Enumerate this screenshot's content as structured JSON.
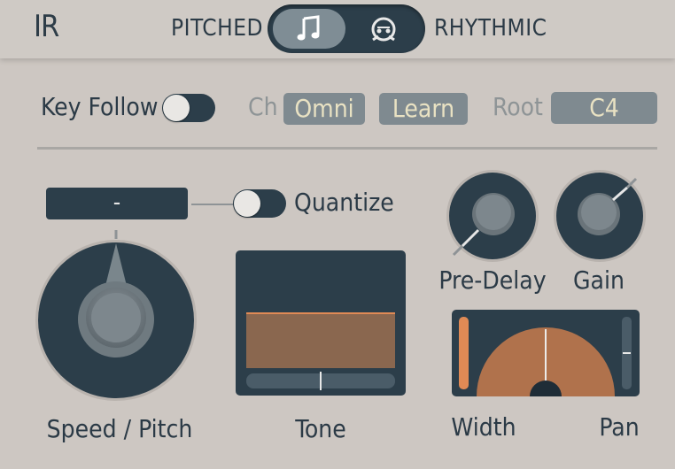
{
  "header": {
    "logo": "IR",
    "mode_left": "PITCHED",
    "mode_right": "RHYTHMIC",
    "selected_mode": "PITCHED"
  },
  "keyrow": {
    "key_follow_label": "Key Follow",
    "key_follow_on": false,
    "ch_label": "Ch",
    "ch_value": "Omni",
    "learn_label": "Learn",
    "root_label": "Root",
    "root_value": "C4"
  },
  "speed": {
    "display_value": "-",
    "quantize_label": "Quantize",
    "quantize_on": false,
    "label": "Speed / Pitch"
  },
  "tone": {
    "label": "Tone",
    "level": 0.55,
    "slider": 0.5
  },
  "predelay": {
    "label": "Pre-Delay",
    "value": 0.0
  },
  "gain": {
    "label": "Gain",
    "value": 1.0
  },
  "width": {
    "label": "Width",
    "value": 1.0
  },
  "pan": {
    "label": "Pan",
    "value": 0.5
  },
  "colors": {
    "panel": "#2c3e4a",
    "accent": "#e08a55",
    "tone_fill": "#8a674f",
    "background": "#cdc7c2"
  },
  "icons": {
    "pitched": "music-note-icon",
    "rhythmic": "drum-icon"
  }
}
